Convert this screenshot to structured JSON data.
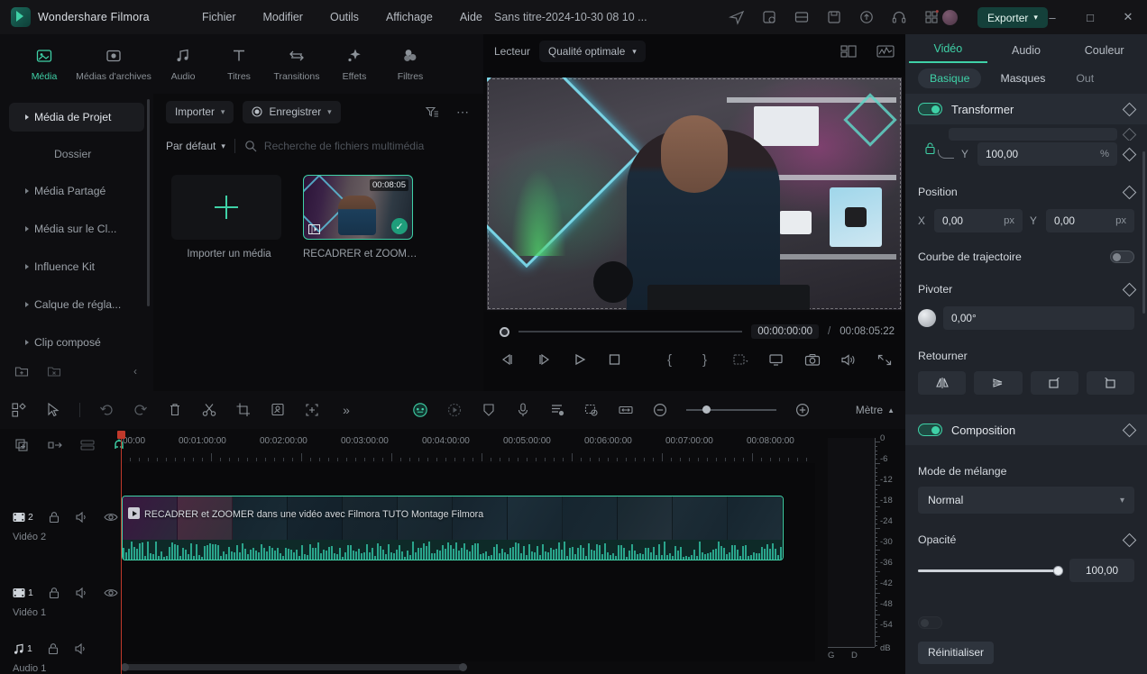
{
  "app": {
    "brand": "Wondershare Filmora",
    "document_title": "Sans titre-2024-10-30 08 10 ...",
    "export_label": "Exporter"
  },
  "menubar": [
    {
      "label": "Fichier"
    },
    {
      "label": "Modifier"
    },
    {
      "label": "Outils"
    },
    {
      "label": "Affichage"
    },
    {
      "label": "Aide"
    }
  ],
  "toolbar_tabs": [
    {
      "label": "Média",
      "icon": "media-icon",
      "active": true
    },
    {
      "label": "Médias d'archives",
      "icon": "stock-media-icon",
      "active": false
    },
    {
      "label": "Audio",
      "icon": "audio-note-icon",
      "active": false
    },
    {
      "label": "Titres",
      "icon": "titles-t-icon",
      "active": false
    },
    {
      "label": "Transitions",
      "icon": "transitions-arrows-icon",
      "active": false
    },
    {
      "label": "Effets",
      "icon": "effects-sparkle-icon",
      "active": false
    },
    {
      "label": "Filtres",
      "icon": "filters-circles-icon",
      "active": false
    }
  ],
  "sidebar": {
    "items": [
      {
        "label": "Média de Projet",
        "active": true,
        "expandable": true
      },
      {
        "label": "Dossier",
        "active": false,
        "expandable": false,
        "sub": true
      },
      {
        "label": "Média Partagé",
        "active": false,
        "expandable": true
      },
      {
        "label": "Média sur le Cl...",
        "active": false,
        "expandable": true
      },
      {
        "label": "Influence Kit",
        "active": false,
        "expandable": true
      },
      {
        "label": "Calque de régla...",
        "active": false,
        "expandable": true
      },
      {
        "label": "Clip composé",
        "active": false,
        "expandable": true
      }
    ]
  },
  "media_panel": {
    "import_label": "Importer",
    "record_label": "Enregistrer",
    "sort_label": "Par défaut",
    "search_placeholder": "Recherche de fichiers multimédia",
    "import_tile_label": "Importer un média",
    "items": [
      {
        "name": "RECADRER et ZOOME...",
        "duration": "00:08:05",
        "selected": true
      }
    ]
  },
  "player": {
    "title": "Lecteur",
    "quality": "Qualité optimale",
    "current_time": "00:00:00:00",
    "separator": "/",
    "total_time": "00:08:05:22"
  },
  "properties": {
    "tabs": [
      {
        "label": "Vidéo",
        "active": true
      },
      {
        "label": "Audio",
        "active": false
      },
      {
        "label": "Couleur",
        "active": false
      }
    ],
    "subtabs": [
      {
        "label": "Basique",
        "active": true
      },
      {
        "label": "Masques",
        "active": false
      },
      {
        "label": "Out",
        "active": false
      }
    ],
    "transform": {
      "title": "Transformer",
      "enabled": true,
      "scale_y_label": "Y",
      "scale_y_value": "100,00",
      "scale_unit": "%",
      "position_label": "Position",
      "pos_x_label": "X",
      "pos_x_value": "0,00",
      "pos_y_label": "Y",
      "pos_y_value": "0,00",
      "pos_unit": "px",
      "curve_label": "Courbe de trajectoire",
      "curve_enabled": false,
      "rotate_label": "Pivoter",
      "rotate_value": "0,00°",
      "flip_label": "Retourner"
    },
    "composition": {
      "title": "Composition",
      "enabled": true,
      "blend_label": "Mode de mélange",
      "blend_value": "Normal",
      "opacity_label": "Opacité",
      "opacity_value": "100,00"
    },
    "reset_label": "Réinitialiser"
  },
  "timeline": {
    "meter_label": "Mètre",
    "ruler_labels": [
      "00:00",
      "00:01:00:00",
      "00:02:00:00",
      "00:03:00:00",
      "00:04:00:00",
      "00:05:00:00",
      "00:06:00:00",
      "00:07:00:00",
      "00:08:00:00"
    ],
    "tracks": [
      {
        "name": "Vidéo 2",
        "index": "2",
        "type": "video"
      },
      {
        "name": "Vidéo 1",
        "index": "1",
        "type": "video"
      },
      {
        "name": "Audio 1",
        "index": "1",
        "type": "audio"
      }
    ],
    "clip": {
      "name": "RECADRER et ZOOMER dans une vidéo avec Filmora  TUTO Montage Filmora"
    },
    "audio_meter": {
      "scale": [
        "0",
        "-6",
        "-12",
        "-18",
        "-24",
        "-30",
        "-36",
        "-42",
        "-48",
        "-54",
        "dB"
      ],
      "channels": [
        "G",
        "D"
      ]
    }
  },
  "colors": {
    "accent": "#3fd1a7",
    "panel_bg": "#20242b",
    "app_bg": "#0b0b0d",
    "playhead": "#c0392b"
  }
}
